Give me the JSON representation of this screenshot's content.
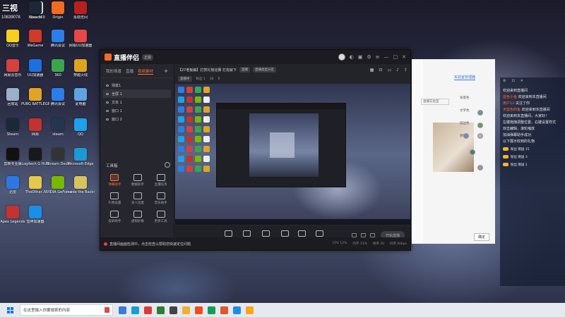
{
  "overlay": {
    "counter": "三视",
    "id": "10839078"
  },
  "desktop_icons": [
    {
      "label": "Xbox 360",
      "color": "#eeeeee"
    },
    {
      "label": "Steam",
      "color": "#1b2838"
    },
    {
      "label": "Origin",
      "color": "#f36b21"
    },
    {
      "label": "永劫无间",
      "color": "#b82020"
    },
    {
      "label": "QQ音乐",
      "color": "#f5d021"
    },
    {
      "label": "WeGame",
      "color": "#d03a2a"
    },
    {
      "label": "腾讯会议",
      "color": "#2b7de9"
    },
    {
      "label": "网易UU加速器",
      "color": "#e84747"
    },
    {
      "label": "网易云音乐",
      "color": "#d6403f"
    },
    {
      "label": "UU加速器",
      "color": "#1d6fe0"
    },
    {
      "label": "360",
      "color": "#3aa74d"
    },
    {
      "label": "穿越火线",
      "color": "#dda41f"
    },
    {
      "label": "回收站",
      "color": "#9ab0c8"
    },
    {
      "label": "PUBG BATTLEGR...",
      "color": "#e0a428"
    },
    {
      "label": "腾讯会议",
      "color": "#2b7de9"
    },
    {
      "label": "此电脑",
      "color": "#5fa4e0"
    },
    {
      "label": "Steam",
      "color": "#1b2838"
    },
    {
      "label": "网易",
      "color": "#c4322d"
    },
    {
      "label": "steam",
      "color": "#24364f"
    },
    {
      "label": "QQ",
      "color": "#1fa0ea"
    },
    {
      "label": "剪映专业版",
      "color": "#111111"
    },
    {
      "label": "Logitech G HUB",
      "color": "#191919"
    },
    {
      "label": "Stream Deck",
      "color": "#333333"
    },
    {
      "label": "Microsoft Edge",
      "color": "#1a9bd6"
    },
    {
      "label": "迅雷",
      "color": "#2c78e2"
    },
    {
      "label": "TheOther...",
      "color": "#e6c84a"
    },
    {
      "label": "NVIDIA GeForce",
      "color": "#76b900"
    },
    {
      "label": "inside the Backrooms",
      "color": "#d8c25e"
    },
    {
      "label": "Apex Legends",
      "color": "#c43232"
    },
    {
      "label": "雷神加速器",
      "color": "#1b8ee8"
    }
  ],
  "app": {
    "name": "直播伴侣",
    "version": "6",
    "version_tag": "正版",
    "tabs": [
      "我的场景",
      "直播",
      "视频素材"
    ],
    "active_tab": "视频素材",
    "scenes": [
      "场景1",
      "全屏 1",
      "文本 1",
      "窗口 1",
      "窗口 2"
    ],
    "toolbox_title": "工具箱",
    "tools": [
      {
        "label": "弹幕助手",
        "hot": true
      },
      {
        "label": "数据助手",
        "hot": false
      },
      {
        "label": "主播任务",
        "hot": false
      },
      {
        "label": "礼物设置",
        "hot": false
      },
      {
        "label": "多人连麦",
        "hot": false
      },
      {
        "label": "音乐助手",
        "hot": false
      },
      {
        "label": "投屏助手",
        "hot": false
      },
      {
        "label": "虚拟形象",
        "hot": false
      },
      {
        "label": "更多工具",
        "hot": false
      }
    ],
    "room": {
      "title": "【27老板娘】打赏礼物比赛 打完就下",
      "tags": [
        "直播",
        "游戏",
        "直播类型分区"
      ],
      "meta": [
        "直播中",
        "粉丝 1",
        "16",
        "0"
      ]
    },
    "controls": [
      "添加素材",
      "摄像头",
      "手机投屏",
      "直播间",
      "麦克风",
      "扬声器"
    ],
    "start_button": "开始直播",
    "status_msg": "直播间画面检测中，点击检查以帮助您快速定位问题",
    "status_stats": [
      "CPU 12%",
      "内存 31%",
      "帧率 30",
      "码率 0kbps"
    ]
  },
  "white_panel": {
    "tab": "实验室管理器",
    "select": "直播实验室",
    "colors": [
      "背景色",
      "文字色",
      "描边色",
      "阴影"
    ],
    "ok": "确定"
  },
  "chat": {
    "lines": [
      {
        "name": "",
        "text": "欢迎来到直播间"
      },
      {
        "name": "蓝色小鱼",
        "text": "欢迎来到本直播间"
      },
      {
        "name": "用户12",
        "text": "关注了你"
      },
      {
        "name": "天蓝色的鱼",
        "text": "欢迎来到本直播间"
      },
      {
        "name": "",
        "text": "欢迎来到本直播间，大家好！"
      },
      {
        "name": "",
        "text": "左键拖拽调整位置，右键设置样式"
      },
      {
        "name": "",
        "text": "双击编辑，滚轮缩放"
      },
      {
        "name": "",
        "text": "加油弹幕助手成功"
      },
      {
        "name": "",
        "text": "以下展示收到的礼物"
      }
    ],
    "gifts": [
      {
        "who": "粉丝",
        "what": "赠送 15"
      },
      {
        "who": "粉丝",
        "what": "赠送 3"
      },
      {
        "who": "粉丝",
        "what": "赠送 1"
      }
    ]
  },
  "taskbar": {
    "search_placeholder": "在这里输入你要搜索的内容",
    "apps": [
      "#3a7bd5",
      "#1a9bd6",
      "#d83b3b",
      "#2e7d32",
      "#444",
      "#f0b030",
      "#e94e1b",
      "#0f9d58",
      "#d95a28",
      "#1b8ee8",
      "#ffa31a"
    ]
  }
}
